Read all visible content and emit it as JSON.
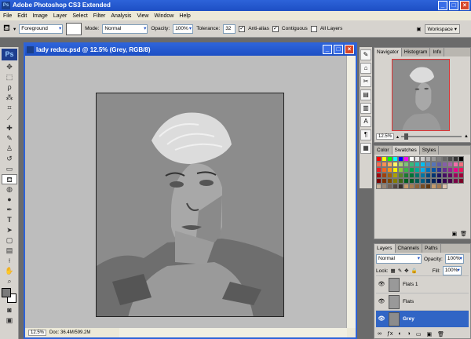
{
  "app": {
    "title": "Adobe Photoshop CS3 Extended"
  },
  "menu": [
    "File",
    "Edit",
    "Image",
    "Layer",
    "Select",
    "Filter",
    "Analysis",
    "View",
    "Window",
    "Help"
  ],
  "options": {
    "source": "Foreground",
    "mode_label": "Mode:",
    "mode": "Normal",
    "opacity_label": "Opacity:",
    "opacity": "100%",
    "tolerance_label": "Tolerance:",
    "tolerance": "32",
    "antialias": "Anti-alias",
    "contiguous": "Contiguous",
    "all_layers": "All Layers",
    "workspace": "Workspace ▾"
  },
  "document": {
    "title": "lady redux.psd @ 12.5% (Grey, RGB/8)",
    "zoom": "12.5%",
    "doc_size": "Doc: 36.4M/599.2M"
  },
  "navigator": {
    "tabs": [
      "Navigator",
      "Histogram",
      "Info"
    ],
    "zoom": "12.5%"
  },
  "swatches_panel": {
    "tabs": [
      "Color",
      "Swatches",
      "Styles"
    ],
    "colors": [
      "#ff0000",
      "#ffff00",
      "#00ff00",
      "#00ffff",
      "#0000ff",
      "#ff00ff",
      "#ffffff",
      "#e6e6e6",
      "#cccccc",
      "#b3b3b3",
      "#999999",
      "#808080",
      "#666666",
      "#4d4d4d",
      "#333333",
      "#000000",
      "#f26c4f",
      "#f68e56",
      "#fbaf5c",
      "#fff467",
      "#acd372",
      "#7cc576",
      "#3bb878",
      "#1abbb4",
      "#00bff3",
      "#438cca",
      "#5574b9",
      "#605ca8",
      "#855fa8",
      "#a763a8",
      "#f06ea9",
      "#f26d7d",
      "#ed1c24",
      "#f26522",
      "#f7941d",
      "#fff200",
      "#8dc63f",
      "#39b54a",
      "#00a651",
      "#00a99d",
      "#00aeef",
      "#0072bc",
      "#0054a6",
      "#2e3192",
      "#662d91",
      "#92278f",
      "#ec008c",
      "#ed145b",
      "#9e0b0f",
      "#a0410d",
      "#a36209",
      "#aba000",
      "#598527",
      "#1a7b30",
      "#007236",
      "#00746b",
      "#0076a3",
      "#004a80",
      "#003471",
      "#1b1464",
      "#440e62",
      "#630460",
      "#9e005d",
      "#9e0039",
      "#790000",
      "#7b2e00",
      "#7d4900",
      "#827b00",
      "#406618",
      "#005e20",
      "#005826",
      "#005952",
      "#005b7f",
      "#003663",
      "#002157",
      "#0d004c",
      "#32004b",
      "#4b0049",
      "#7b0046",
      "#7a0026",
      "#c7b299",
      "#998675",
      "#736357",
      "#534741",
      "#37302d",
      "#c69c6d",
      "#a67c52",
      "#8c6239",
      "#754c24",
      "#603913"
    ],
    "extra_colors": [
      "#c69c6d",
      "#a67c52",
      "#ddc4ae"
    ]
  },
  "layers_panel": {
    "tabs": [
      "Layers",
      "Channels",
      "Paths"
    ],
    "blend_mode": "Normal",
    "opacity_label": "Opacity:",
    "opacity": "100%",
    "lock_label": "Lock:",
    "fill_label": "Fill:",
    "fill": "100%",
    "layers": [
      {
        "name": "Flats 1",
        "selected": false
      },
      {
        "name": "Flats",
        "selected": false
      },
      {
        "name": "Grey",
        "selected": true
      }
    ]
  },
  "status": {
    "progress": ""
  }
}
